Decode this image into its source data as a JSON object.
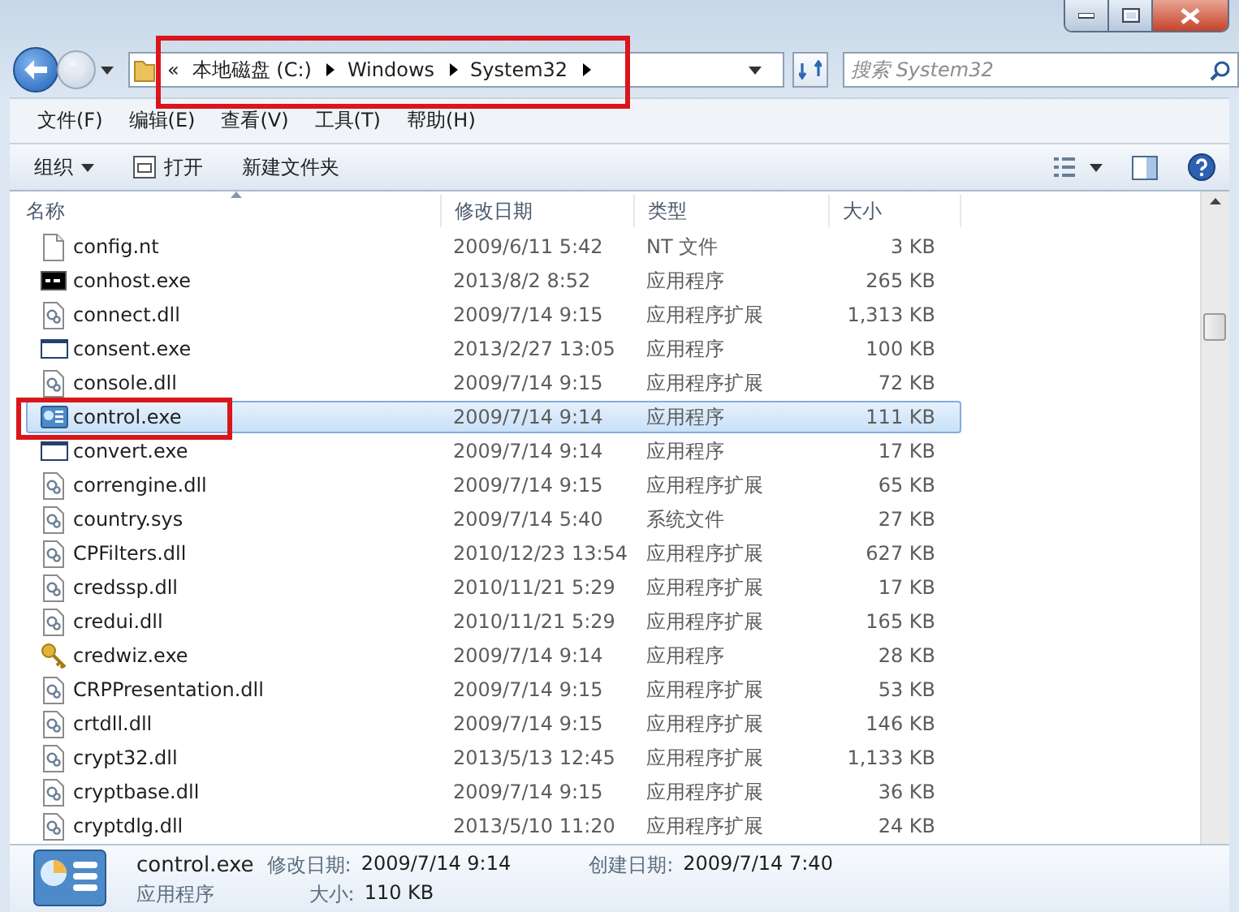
{
  "address_bar": {
    "outlined": true,
    "overflow": "«",
    "crumbs": [
      "本地磁盘 (C:)",
      "Windows",
      "System32"
    ]
  },
  "search": {
    "placeholder": "搜索 System32"
  },
  "menu": [
    "文件(F)",
    "编辑(E)",
    "查看(V)",
    "工具(T)",
    "帮助(H)"
  ],
  "toolbar": {
    "organize": "组织",
    "open": "打开",
    "new_folder": "新建文件夹"
  },
  "columns": [
    "名称",
    "修改日期",
    "类型",
    "大小"
  ],
  "rows": [
    {
      "name": "config.nt",
      "date": "2009/6/11 5:42",
      "type": "NT 文件",
      "size": "3 KB",
      "kind": "file",
      "selected": false,
      "outlined": false
    },
    {
      "name": "conhost.exe",
      "date": "2013/8/2 8:52",
      "type": "应用程序",
      "size": "265 KB",
      "kind": "console",
      "selected": false,
      "outlined": false
    },
    {
      "name": "connect.dll",
      "date": "2009/7/14 9:15",
      "type": "应用程序扩展",
      "size": "1,313 KB",
      "kind": "dll",
      "selected": false,
      "outlined": false
    },
    {
      "name": "consent.exe",
      "date": "2013/2/27 13:05",
      "type": "应用程序",
      "size": "100 KB",
      "kind": "window",
      "selected": false,
      "outlined": false
    },
    {
      "name": "console.dll",
      "date": "2009/7/14 9:15",
      "type": "应用程序扩展",
      "size": "72 KB",
      "kind": "dll",
      "selected": false,
      "outlined": false
    },
    {
      "name": "control.exe",
      "date": "2009/7/14 9:14",
      "type": "应用程序",
      "size": "111 KB",
      "kind": "control",
      "selected": true,
      "outlined": true
    },
    {
      "name": "convert.exe",
      "date": "2009/7/14 9:14",
      "type": "应用程序",
      "size": "17 KB",
      "kind": "window",
      "selected": false,
      "outlined": false
    },
    {
      "name": "correngine.dll",
      "date": "2009/7/14 9:15",
      "type": "应用程序扩展",
      "size": "65 KB",
      "kind": "dll",
      "selected": false,
      "outlined": false
    },
    {
      "name": "country.sys",
      "date": "2009/7/14 5:40",
      "type": "系统文件",
      "size": "27 KB",
      "kind": "dll",
      "selected": false,
      "outlined": false
    },
    {
      "name": "CPFilters.dll",
      "date": "2010/12/23 13:54",
      "type": "应用程序扩展",
      "size": "627 KB",
      "kind": "dll",
      "selected": false,
      "outlined": false
    },
    {
      "name": "credssp.dll",
      "date": "2010/11/21 5:29",
      "type": "应用程序扩展",
      "size": "17 KB",
      "kind": "dll",
      "selected": false,
      "outlined": false
    },
    {
      "name": "credui.dll",
      "date": "2010/11/21 5:29",
      "type": "应用程序扩展",
      "size": "165 KB",
      "kind": "dll",
      "selected": false,
      "outlined": false
    },
    {
      "name": "credwiz.exe",
      "date": "2009/7/14 9:14",
      "type": "应用程序",
      "size": "28 KB",
      "kind": "key",
      "selected": false,
      "outlined": false
    },
    {
      "name": "CRPPresentation.dll",
      "date": "2009/7/14 9:15",
      "type": "应用程序扩展",
      "size": "53 KB",
      "kind": "dll",
      "selected": false,
      "outlined": false
    },
    {
      "name": "crtdll.dll",
      "date": "2009/7/14 9:15",
      "type": "应用程序扩展",
      "size": "146 KB",
      "kind": "dll",
      "selected": false,
      "outlined": false
    },
    {
      "name": "crypt32.dll",
      "date": "2013/5/13 12:45",
      "type": "应用程序扩展",
      "size": "1,133 KB",
      "kind": "dll",
      "selected": false,
      "outlined": false
    },
    {
      "name": "cryptbase.dll",
      "date": "2009/7/14 9:15",
      "type": "应用程序扩展",
      "size": "36 KB",
      "kind": "dll",
      "selected": false,
      "outlined": false
    },
    {
      "name": "cryptdlg.dll",
      "date": "2013/5/10 11:20",
      "type": "应用程序扩展",
      "size": "24 KB",
      "kind": "dll",
      "selected": false,
      "outlined": false
    }
  ],
  "details": {
    "name": "control.exe",
    "type": "应用程序",
    "modified_label": "修改日期:",
    "modified": "2009/7/14 9:14",
    "created_label": "创建日期:",
    "created": "2009/7/14 7:40",
    "size_label": "大小:",
    "size": "110 KB"
  }
}
